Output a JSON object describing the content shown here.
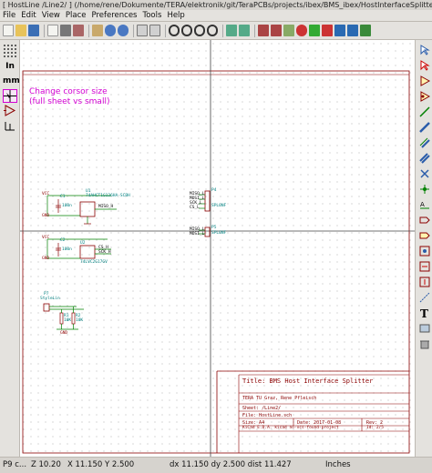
{
  "window": {
    "title": "[ HostLine /Line2/ ] (/home/rene/Dokumente/TERA/elektronik/git/TeraPCBs/projects/ibex/BMS_ibex/HostInterfaceSplitter/H"
  },
  "menu": [
    "File",
    "Edit",
    "View",
    "Place",
    "Preferences",
    "Tools",
    "Help"
  ],
  "left_toolbar": {
    "grid_label": "",
    "units_in": "In",
    "units_mm": "mm"
  },
  "tooltip": {
    "line1": "Change corsor size",
    "line2": "(full sheet vs small)"
  },
  "schematic": {
    "u1_ref": "U1",
    "u1_value": "74AHCT1G126HA-SCBH",
    "c1": "C1",
    "c1_value": "100n",
    "net_miso_h": "MISO_H",
    "net_vcc": "VCC",
    "net_gnd": "GND",
    "p4_ref": "P4",
    "p4_value": "SPL0NF",
    "p4_pins": [
      "MISO_L",
      "MOSI_L",
      "SCK_L",
      "CS_L"
    ],
    "p5_ref": "P5",
    "p5_value": "SPL0NF",
    "p5_pins": [
      "MISO_L",
      "MOSI_L"
    ],
    "u2_ref": "U2",
    "u2_value": "74LVC2G17GV",
    "c2": "C2",
    "c2_value": "100n",
    "net_cs_h": "CS_H",
    "net_sck_h": "SCK_H",
    "p7_ref": "P7",
    "p7_value": "StyleLin",
    "r1": "R1",
    "r1_value": "10K",
    "r2": "R2",
    "r2_value": "10K"
  },
  "title_block": {
    "title": "Title: BMS Host Interface Splitter",
    "company": "TERA TU Graz, Rene Pfleisch",
    "sheet": "Sheet: /Line2/",
    "file": "File: HostLine.sch",
    "size": "Size: A4",
    "date": "Date: 2017-01-08",
    "rev": "Rev: 2",
    "kicad": "KiCad E.D.A.  kicad no-vcs-found-project",
    "id": "Id: 2/5"
  },
  "status": {
    "part": "P9 c...",
    "zoom": "Z 10.20",
    "xy": "X 11.150  Y 2.500",
    "dxy": "dx 11.150  dy 2.500  dist 11.427",
    "units": "Inches"
  },
  "colors": {
    "wire": "#008000",
    "component": "#8b0000",
    "label": "#008080",
    "cursor": "#333333",
    "tooltip": "#d200d2"
  }
}
